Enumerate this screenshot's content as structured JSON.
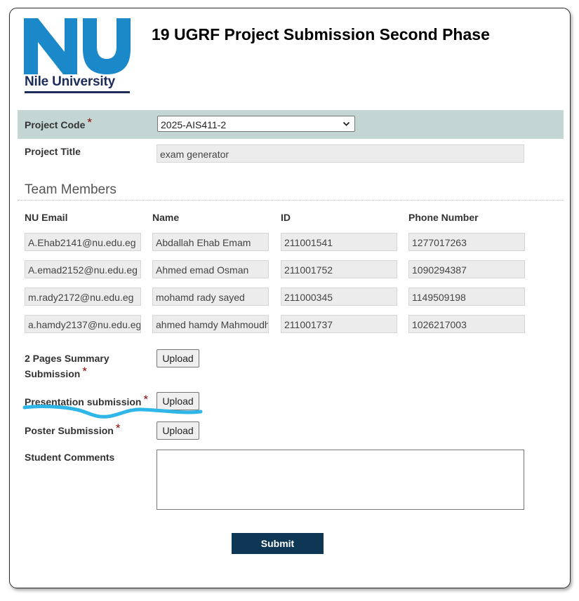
{
  "header": {
    "logo_text": "Nile University",
    "title": "19 UGRF Project Submission Second Phase"
  },
  "colors": {
    "logo_blue": "#1a88c9",
    "logo_navy": "#1c2b5a",
    "row_highlight": "#c4d6d3",
    "submit_bg": "#0d3755",
    "required": "#8b0000",
    "annotation": "#2fb6e8"
  },
  "form": {
    "project_code_label": "Project Code",
    "project_code_value": "2025-AIS411-2",
    "project_title_label": "Project Title",
    "project_title_value": "exam generator",
    "required_mark": "*"
  },
  "team": {
    "section_title": "Team Members",
    "columns": [
      "NU Email",
      "Name",
      "ID",
      "Phone Number"
    ],
    "rows": [
      [
        "A.Ehab2141@nu.edu.eg",
        "Abdallah Ehab Emam",
        "211001541",
        "1277017263"
      ],
      [
        "A.emad2152@nu.edu.eg",
        "Ahmed emad Osman",
        "211001752",
        "1090294387"
      ],
      [
        "m.rady2172@nu.edu.eg",
        "mohamd rady sayed",
        "211000345",
        "1149509198"
      ],
      [
        "a.hamdy2137@nu.edu.eg",
        "ahmed hamdy Mahmoudh",
        "211001737",
        "1026217003"
      ]
    ]
  },
  "uploads": {
    "summary_label_line1": "2 Pages Summary",
    "summary_label_line2": "Submission",
    "presentation_label": "Presentation submission",
    "poster_label": "Poster Submission",
    "button_label": "Upload"
  },
  "comments": {
    "label": "Student Comments",
    "value": ""
  },
  "submit_label": "Submit",
  "icons": [
    "nile-university-logo",
    "chevron-down-icon",
    "hand-drawn-underline"
  ]
}
